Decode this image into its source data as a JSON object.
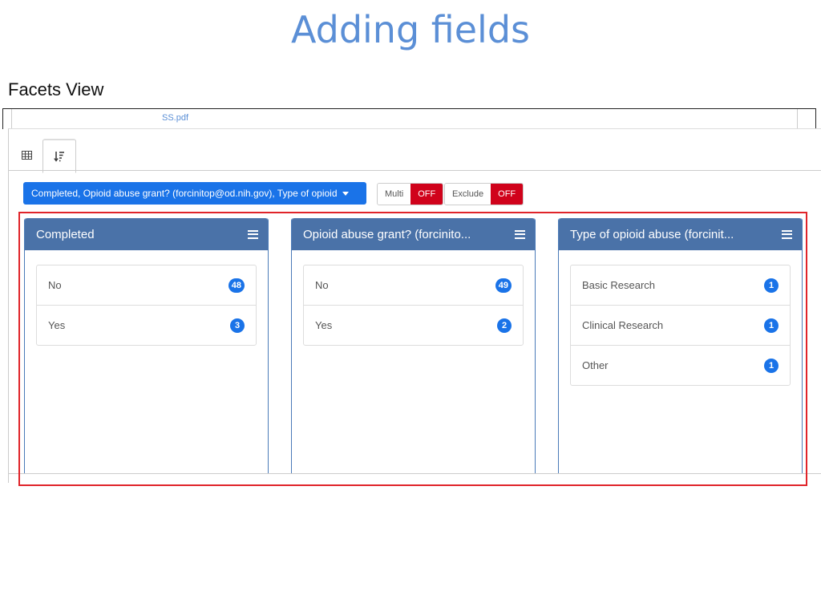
{
  "slide": {
    "title": "Adding fields",
    "subtitle": "Facets View"
  },
  "crop": {
    "file_link": "SS.pdf"
  },
  "field_select": {
    "label": "Completed, Opioid abuse grant? (forcinitop@od.nih.gov), Type of opioid"
  },
  "toggles": {
    "multi": {
      "label": "Multi",
      "state": "OFF"
    },
    "exclude": {
      "label": "Exclude",
      "state": "OFF"
    }
  },
  "panels": [
    {
      "title": "Completed",
      "items": [
        {
          "label": "No",
          "count": "48"
        },
        {
          "label": "Yes",
          "count": "3"
        }
      ]
    },
    {
      "title": "Opioid abuse grant? (forcinito...",
      "items": [
        {
          "label": "No",
          "count": "49"
        },
        {
          "label": "Yes",
          "count": "2"
        }
      ]
    },
    {
      "title": "Type of opioid abuse (forcinit...",
      "items": [
        {
          "label": "Basic Research",
          "count": "1"
        },
        {
          "label": "Clinical Research",
          "count": "1"
        },
        {
          "label": "Other",
          "count": "1"
        }
      ]
    }
  ],
  "colors": {
    "accent": "#1a73e8",
    "panel_header": "#4a72a8",
    "toggle_off": "#d0021b",
    "highlight": "#e0242a",
    "title": "#5b8fd6"
  },
  "icons": {
    "tab_table": "table-icon",
    "tab_facets": "sort-list-icon",
    "panel_menu": "hamburger-icon"
  }
}
